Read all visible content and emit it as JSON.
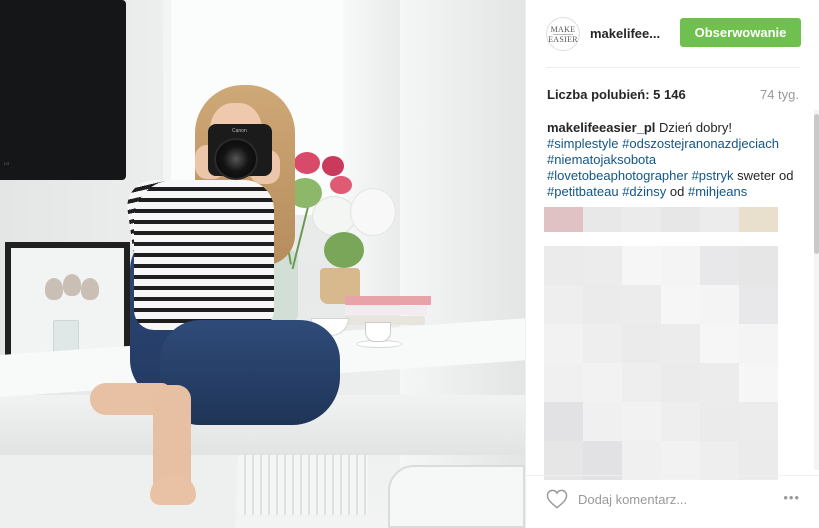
{
  "header": {
    "avatar_line1": "MAKE",
    "avatar_line2": "EASIER",
    "username": "makelifee...",
    "follow_label": "Obserwowanie"
  },
  "stats": {
    "likes_label": "Liczba polubień: 5 146",
    "age": "74 tyg."
  },
  "caption": {
    "username": "makelifeeasier_pl",
    "text_1": " Dzień dobry! ",
    "tag_1": "#simplestyle",
    "tag_2": "#odszostejranonazdjeciach",
    "tag_3": "#niematojaksobota",
    "tag_4": "#lovetobeaphotographer",
    "tag_5": "#pstryk",
    "text_2": " sweter od ",
    "tag_6": "#petitbateau",
    "tag_7": "#dżinsy",
    "text_3": " od ",
    "tag_8": "#mihjeans"
  },
  "comments": {
    "placeholder": "Dodaj komentarz...",
    "more_label": "•••"
  },
  "photo": {
    "tv_brand": "LG",
    "camera_brand": "Canon"
  },
  "colors": {
    "follow_button": "#70c050",
    "hashtag": "#125688",
    "secondary_text": "#999999"
  },
  "icons": {
    "like": "heart-outline-icon",
    "more": "ellipsis-icon"
  }
}
